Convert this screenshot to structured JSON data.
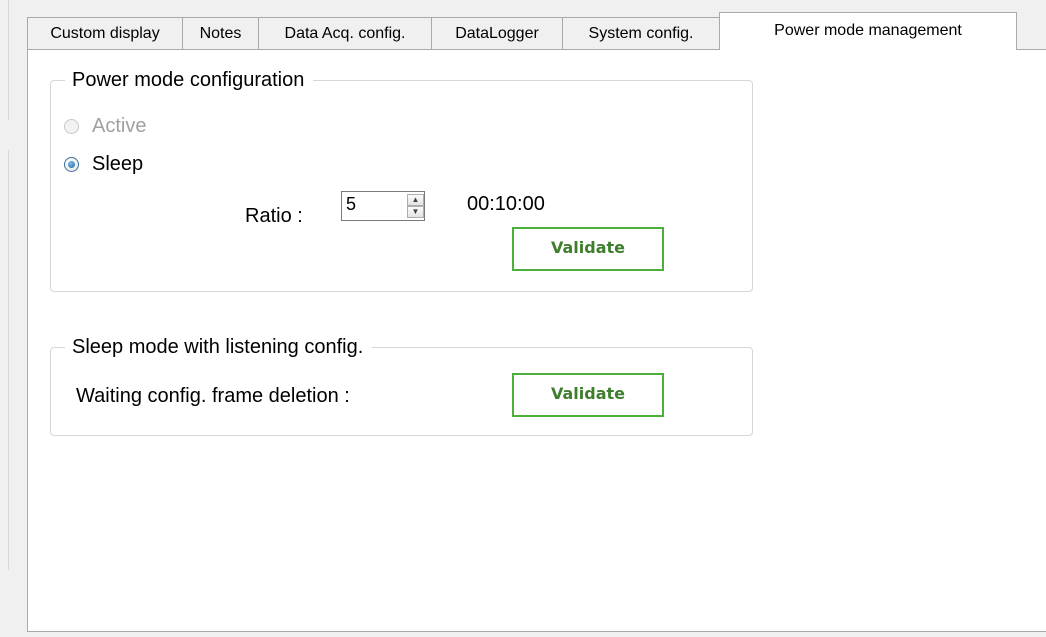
{
  "tabs": [
    {
      "label": "Custom display"
    },
    {
      "label": "Notes"
    },
    {
      "label": "Data Acq. config."
    },
    {
      "label": "DataLogger"
    },
    {
      "label": "System config."
    },
    {
      "label": "Power mode management",
      "active": true
    }
  ],
  "power_mode": {
    "title": "Power mode configuration",
    "options": [
      {
        "label": "Active",
        "enabled": false,
        "checked": false
      },
      {
        "label": "Sleep",
        "enabled": true,
        "checked": true
      }
    ],
    "ratio_label": "Ratio :",
    "ratio_value": "5",
    "interval": "00:10:00",
    "validate_label": "Validate"
  },
  "sleep_listening": {
    "title": "Sleep mode with listening config.",
    "deletion_label": "Waiting config. frame deletion :",
    "validate_label": "Validate"
  },
  "colors": {
    "validate_border": "#4caf3a",
    "validate_text": "#3e7e2c",
    "radio_checked": "#1a5f9e"
  },
  "icons": {
    "spin_up": "triangle-up",
    "spin_down": "triangle-down"
  }
}
